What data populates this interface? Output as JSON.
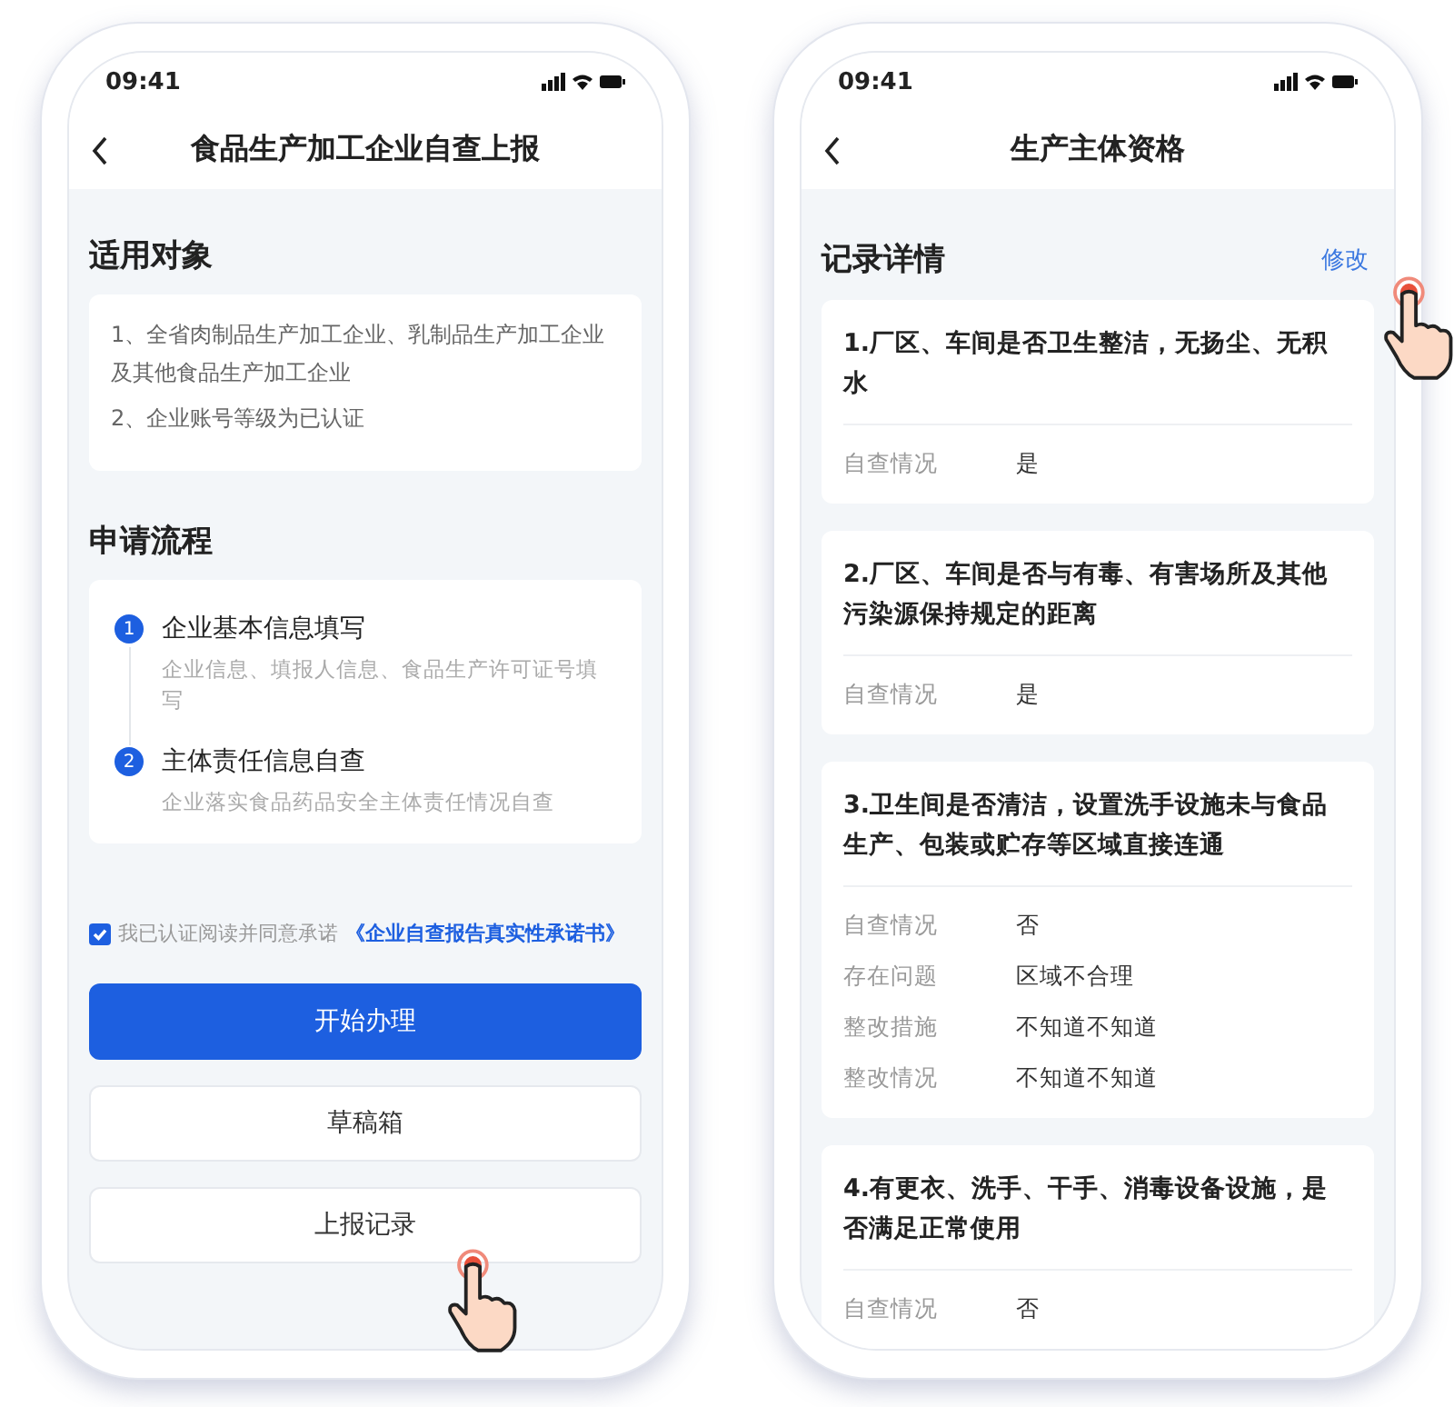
{
  "left_screen": {
    "status_time": "09:41",
    "title": "食品生产加工企业自查上报",
    "scope": {
      "heading": "适用对象",
      "lines": [
        "1、全省肉制品生产加工企业、乳制品生产加工企业及其他食品生产加工企业",
        "2、企业账号等级为已认证"
      ]
    },
    "process": {
      "heading": "申请流程",
      "steps": [
        {
          "number": "1",
          "title": "企业基本信息填写",
          "description": "企业信息、填报人信息、食品生产许可证号填写"
        },
        {
          "number": "2",
          "title": "主体责任信息自查",
          "description": "企业落实食品药品安全主体责任情况自查"
        }
      ]
    },
    "agreement": {
      "checked": true,
      "text": "我已认证阅读并同意承诺",
      "link": "《企业自查报告真实性承诺书》"
    },
    "buttons": [
      {
        "kind": "primary",
        "label": "开始办理"
      },
      {
        "kind": "secondary",
        "label": "草稿箱"
      },
      {
        "kind": "secondary",
        "label": "上报记录"
      }
    ]
  },
  "right_screen": {
    "status_time": "09:41",
    "title": "生产主体资格",
    "heading": "记录详情",
    "edit_link": "修改",
    "items": [
      {
        "question": "1.厂区、车间是否卫生整洁，无扬尘、无积水",
        "fields": [
          {
            "label": "自查情况",
            "value": "是"
          }
        ]
      },
      {
        "question": "2.厂区、车间是否与有毒、有害场所及其他污染源保持规定的距离",
        "fields": [
          {
            "label": "自查情况",
            "value": "是"
          }
        ]
      },
      {
        "question": "3.卫生间是否清洁，设置洗手设施未与食品生产、包装或贮存等区域直接连通",
        "fields": [
          {
            "label": "自查情况",
            "value": "否"
          },
          {
            "label": "存在问题",
            "value": "区域不合理"
          },
          {
            "label": "整改措施",
            "value": "不知道不知道"
          },
          {
            "label": "整改情况",
            "value": "不知道不知道"
          }
        ]
      },
      {
        "question": "4.有更衣、洗手、干手、消毒设备设施，是否满足正常使用",
        "fields": [
          {
            "label": "自查情况",
            "value": "否"
          }
        ]
      }
    ]
  }
}
